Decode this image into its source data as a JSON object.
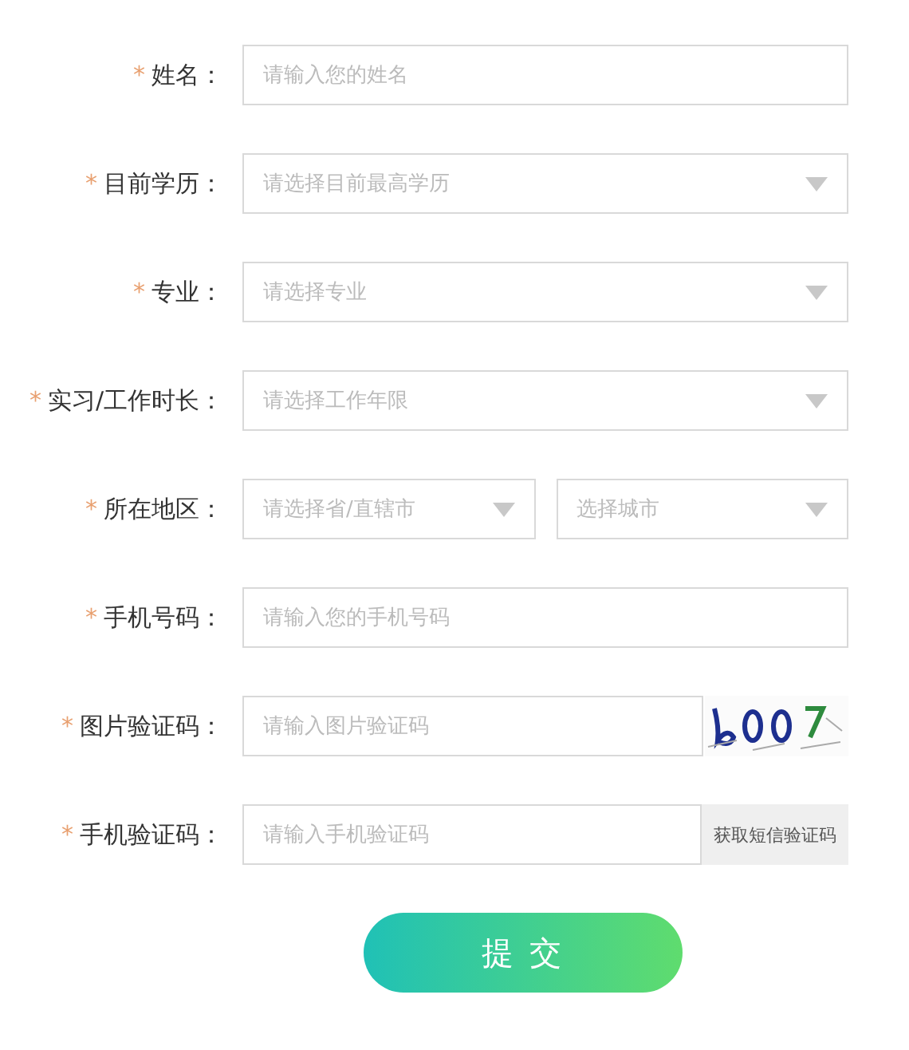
{
  "fields": [
    {
      "kind": "input",
      "required_mark": "*",
      "label": "姓名：",
      "placeholder": "请输入您的姓名"
    },
    {
      "kind": "select",
      "required_mark": "*",
      "label": "目前学历：",
      "placeholder": "请选择目前最高学历"
    },
    {
      "kind": "select",
      "required_mark": "*",
      "label": "专业：",
      "placeholder": "请选择专业"
    },
    {
      "kind": "select",
      "required_mark": "*",
      "label": "实习/工作时长：",
      "placeholder": "请选择工作年限"
    },
    {
      "kind": "select_pair",
      "required_mark": "*",
      "label": "所在地区：",
      "placeholder": "请选择省/直辖市",
      "second_placeholder": "选择城市"
    },
    {
      "kind": "input",
      "required_mark": "*",
      "label": "手机号码：",
      "placeholder": "请输入您的手机号码"
    },
    {
      "kind": "captcha",
      "required_mark": "*",
      "label": "图片验证码：",
      "placeholder": "请输入图片验证码"
    },
    {
      "kind": "sms",
      "required_mark": "*",
      "label": "手机验证码：",
      "placeholder": "请输入手机验证码",
      "button": "获取短信验证码"
    }
  ],
  "submit": "提 交"
}
